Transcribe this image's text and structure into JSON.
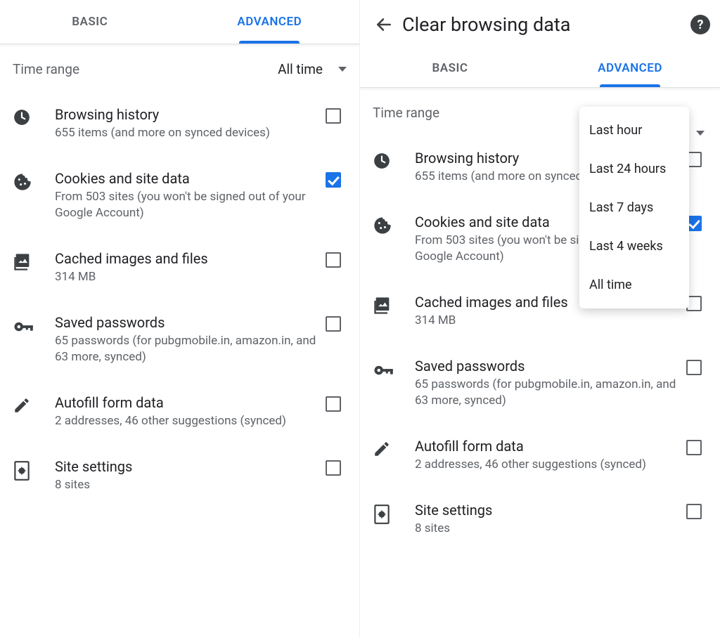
{
  "left": {
    "tabs": {
      "basic": "BASIC",
      "advanced": "ADVANCED"
    },
    "time_range": {
      "label": "Time range",
      "value": "All time"
    },
    "items": [
      {
        "title": "Browsing history",
        "sub": "655 items (and more on synced devices)",
        "checked": false
      },
      {
        "title": "Cookies and site data",
        "sub": "From 503 sites (you won't be signed out of your Google Account)",
        "checked": true
      },
      {
        "title": "Cached images and files",
        "sub": "314 MB",
        "checked": false
      },
      {
        "title": "Saved passwords",
        "sub": "65 passwords (for pubgmobile.in, amazon.in, and 63 more, synced)",
        "checked": false
      },
      {
        "title": "Autofill form data",
        "sub": "2 addresses, 46 other suggestions (synced)",
        "checked": false
      },
      {
        "title": "Site settings",
        "sub": "8 sites",
        "checked": false
      }
    ]
  },
  "right": {
    "title": "Clear browsing data",
    "tabs": {
      "basic": "BASIC",
      "advanced": "ADVANCED"
    },
    "time_range": {
      "label": "Time range"
    },
    "dropdown_options": [
      "Last hour",
      "Last 24 hours",
      "Last 7 days",
      "Last 4 weeks",
      "All time"
    ],
    "items": [
      {
        "title": "Browsing history",
        "sub": "655 items (and more on synced devices)",
        "checked": false
      },
      {
        "title": "Cookies and site data",
        "sub": "From 503 sites (you won't be signed out of your Google Account)",
        "checked": true
      },
      {
        "title": "Cached images and files",
        "sub": "314 MB",
        "checked": false
      },
      {
        "title": "Saved passwords",
        "sub": "65 passwords (for pubgmobile.in, amazon.in, and 63 more, synced)",
        "checked": false
      },
      {
        "title": "Autofill form data",
        "sub": "2 addresses, 46 other suggestions (synced)",
        "checked": false
      },
      {
        "title": "Site settings",
        "sub": "8 sites",
        "checked": false
      }
    ]
  }
}
